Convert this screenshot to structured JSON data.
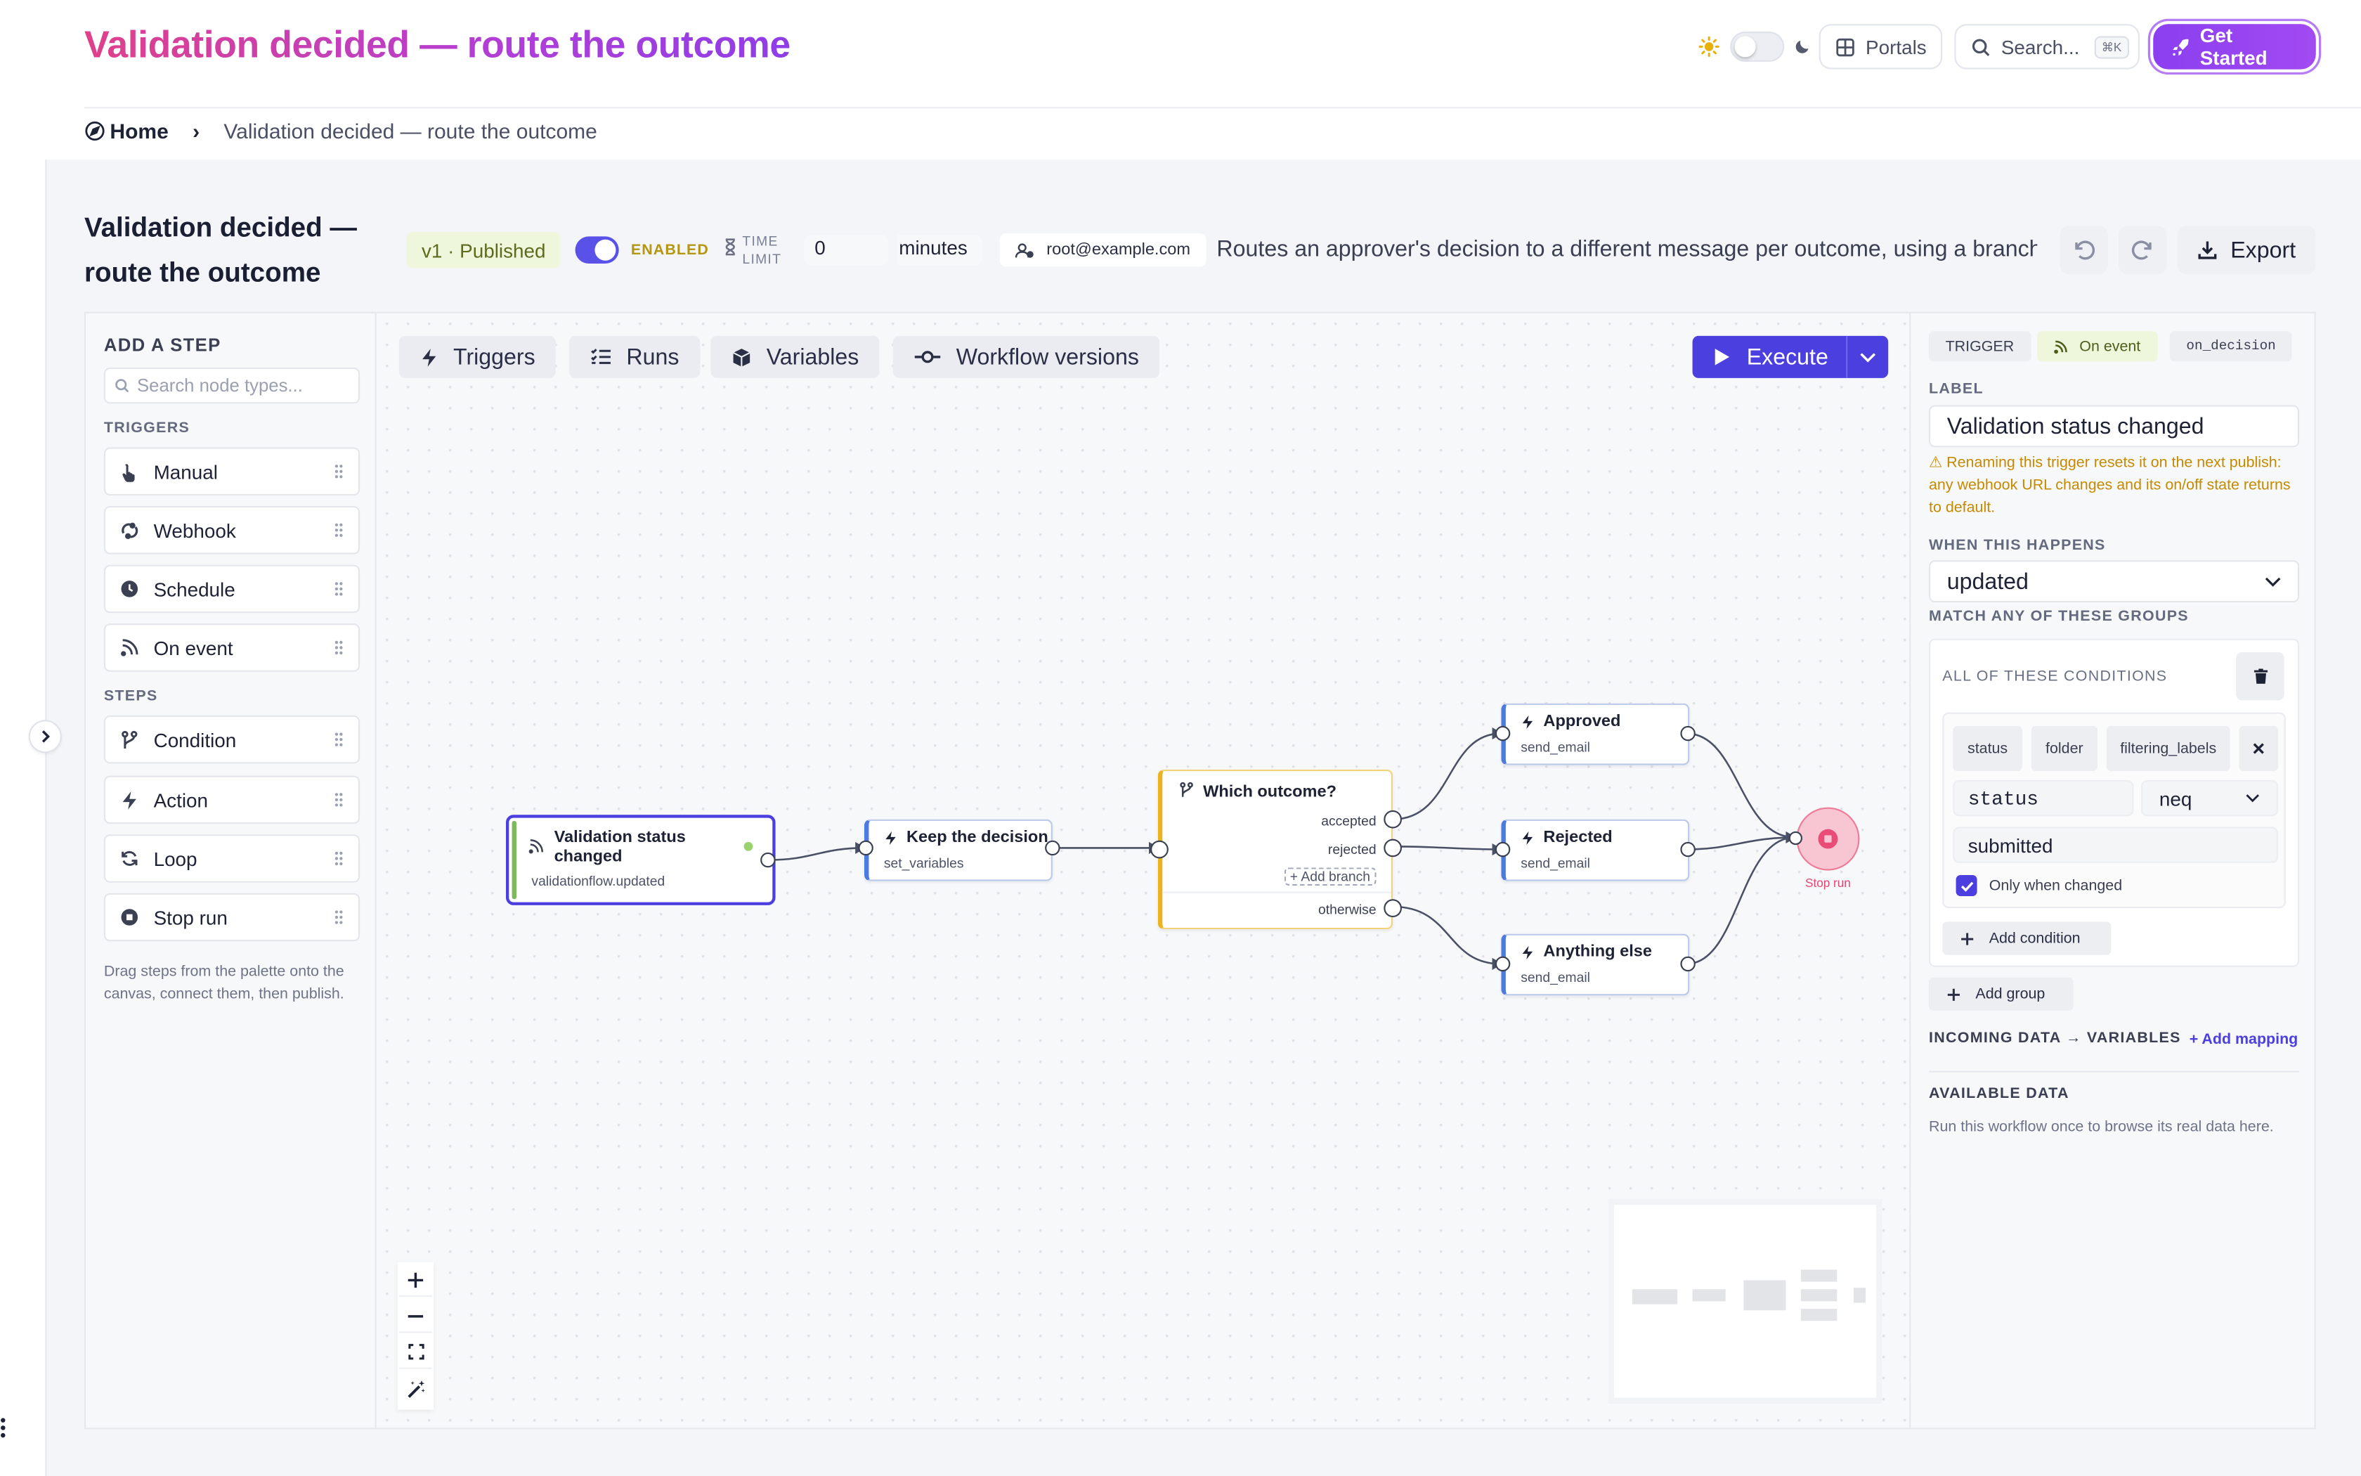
{
  "header": {
    "title": "Validation decided — route the outcome",
    "portals_label": "Portals",
    "search_placeholder": "Search...",
    "search_shortcut": "⌘K",
    "get_started_label": "Get Started"
  },
  "breadcrumb": {
    "home": "Home",
    "separator": "›",
    "current": "Validation decided — route the outcome"
  },
  "workflow": {
    "title_line1": "Validation decided —",
    "title_line2": "route the outcome",
    "version_badge": "v1 · Published",
    "enabled_label": "ENABLED",
    "time_limit_line1": "TIME",
    "time_limit_line2": "LIMIT",
    "time_limit_value": "0",
    "time_limit_unit": "minutes",
    "owner": "root@example.com",
    "description": "Routes an approver's decision to a different message per outcome, using a branch. ...",
    "export_label": "Export"
  },
  "palette": {
    "heading": "ADD A STEP",
    "search_placeholder": "Search node types...",
    "triggers_heading": "TRIGGERS",
    "triggers": [
      {
        "label": "Manual",
        "icon": "hand-pointer-icon"
      },
      {
        "label": "Webhook",
        "icon": "webhook-icon"
      },
      {
        "label": "Schedule",
        "icon": "clock-icon"
      },
      {
        "label": "On event",
        "icon": "rss-icon"
      }
    ],
    "steps_heading": "STEPS",
    "steps": [
      {
        "label": "Condition",
        "icon": "branch-icon"
      },
      {
        "label": "Action",
        "icon": "bolt-icon"
      },
      {
        "label": "Loop",
        "icon": "loop-icon"
      },
      {
        "label": "Stop run",
        "icon": "stop-icon"
      }
    ],
    "help_text": "Drag steps from the palette onto the canvas, connect them, then publish."
  },
  "toolbar": {
    "triggers": "Triggers",
    "runs": "Runs",
    "variables": "Variables",
    "versions": "Workflow versions",
    "execute": "Execute"
  },
  "nodes": {
    "trigger": {
      "title_line1": "Validation status",
      "title_line2": "changed",
      "sub": "validationflow.updated"
    },
    "keep": {
      "title": "Keep the decision",
      "sub": "set_variables"
    },
    "branch": {
      "title": "Which outcome?",
      "out1": "accepted",
      "out2": "rejected",
      "add_branch": "+ Add branch",
      "otherwise": "otherwise"
    },
    "approved": {
      "title": "Approved",
      "sub": "send_email"
    },
    "rejected": {
      "title": "Rejected",
      "sub": "send_email"
    },
    "else": {
      "title": "Anything else",
      "sub": "send_email"
    },
    "stop": {
      "label": "Stop run"
    }
  },
  "inspector": {
    "chip_type": "TRIGGER",
    "chip_kind": "On event",
    "chip_key": "on_decision",
    "label_heading": "LABEL",
    "label_value": "Validation status changed",
    "warning": "⚠ Renaming this trigger resets it on the next publish: any webhook URL changes and its on/off state returns to default.",
    "when_heading": "WHEN THIS HAPPENS",
    "when_value": "updated",
    "match_heading": "MATCH ANY OF THESE GROUPS",
    "all_conditions": "ALL OF THESE CONDITIONS",
    "field_chips": [
      "status",
      "folder",
      "filtering_labels"
    ],
    "cond_field": "status",
    "cond_operator": "neq",
    "cond_value": "submitted",
    "only_changed": "Only when changed",
    "add_condition": "Add condition",
    "add_group": "Add group",
    "incoming_heading": "INCOMING DATA → VARIABLES",
    "add_mapping": "+ Add mapping",
    "available_heading": "AVAILABLE DATA",
    "available_text": "Run this workflow once to browse its real data here."
  },
  "colors": {
    "accent": "#4b3fe0",
    "title_gradient_start": "#e0408a",
    "title_gradient_end": "#8e3ee6",
    "branch_border": "#f0c040",
    "trigger_border": "#4b3fe0",
    "stop_fill": "#f6b6c6",
    "warning": "#c58a00"
  }
}
